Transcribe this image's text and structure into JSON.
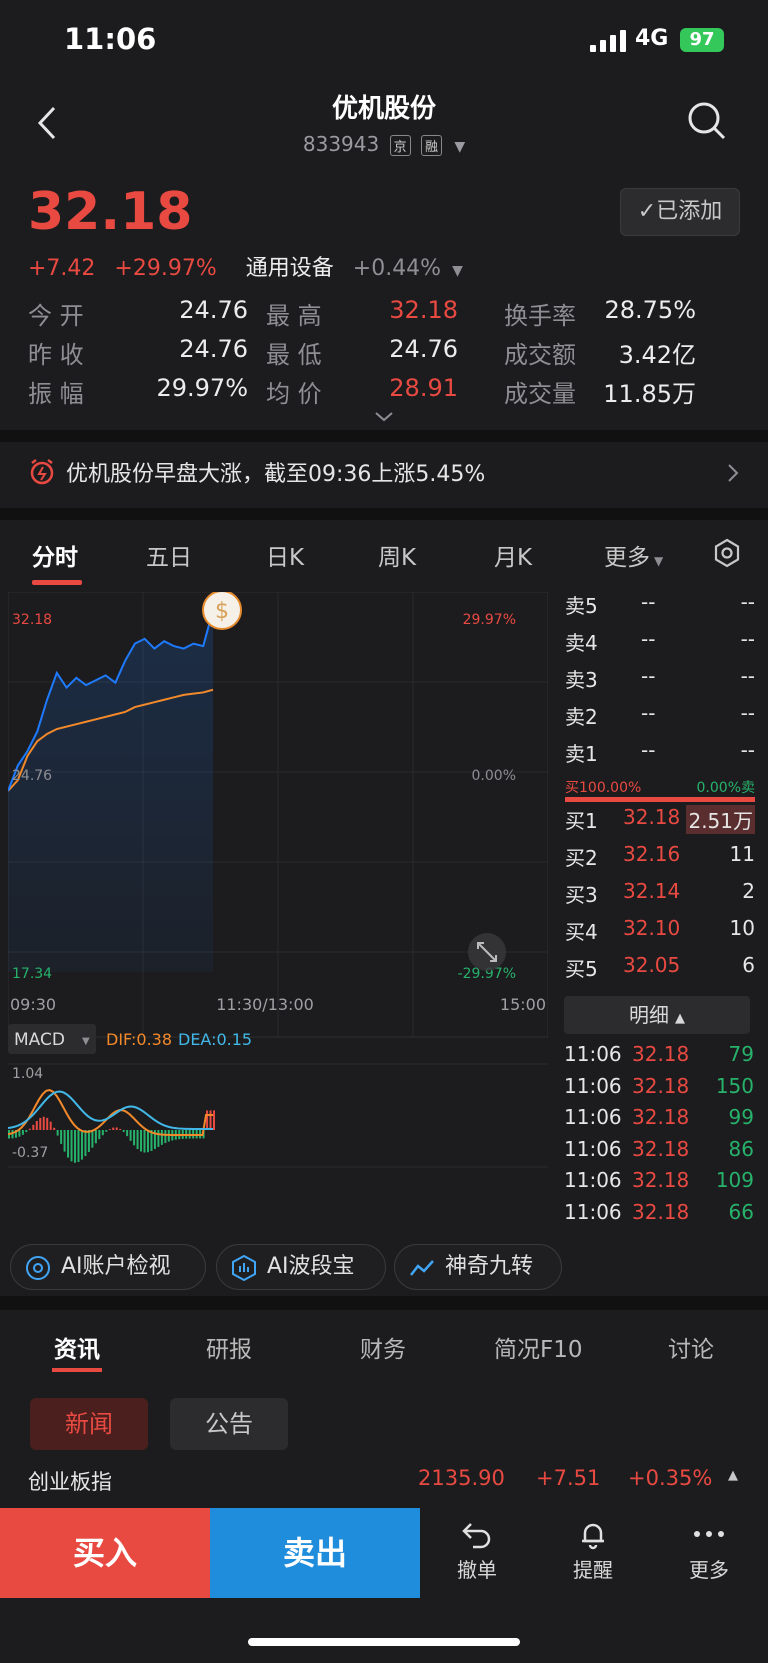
{
  "status_bar": {
    "time": "11:06",
    "network": "4G",
    "battery": "97"
  },
  "header": {
    "title": "优机股份",
    "code": "833943",
    "tag1": "京",
    "tag2": "融",
    "added_label": "✓已添加"
  },
  "quote": {
    "price": "32.18",
    "change": "+7.42",
    "change_pct": "+29.97%",
    "sector": "通用设备",
    "sector_pct": "+0.44%",
    "rows": [
      {
        "l1": "今 开",
        "v1": "24.76",
        "l2": "最 高",
        "v2": "32.18",
        "l3": "换手率",
        "v3": "28.75%"
      },
      {
        "l1": "昨 收",
        "v1": "24.76",
        "l2": "最 低",
        "v2": "24.76",
        "l3": "成交额",
        "v3": "3.42亿"
      },
      {
        "l1": "振 幅",
        "v1": "29.97%",
        "l2": "均 价",
        "v2": "28.91",
        "l3": "成交量",
        "v3": "11.85万"
      }
    ]
  },
  "news_alert": "优机股份早盘大涨，截至09:36上涨5.45%",
  "tabs": [
    "分时",
    "五日",
    "日K",
    "周K",
    "月K",
    "更多"
  ],
  "chart": {
    "price_top": "32.18",
    "pct_top": "29.97%",
    "price_mid": "24.76",
    "pct_mid": "0.00%",
    "price_bottom": "17.34",
    "pct_bottom": "-29.97%",
    "time_start": "09:30",
    "time_mid": "11:30/13:00",
    "time_end": "15:00",
    "macd_label": "MACD",
    "dif": "DIF:0.38",
    "dea": "DEA:0.15",
    "macd_max": "1.04",
    "macd_min": "-0.37",
    "marker": "$"
  },
  "chart_data": {
    "type": "line",
    "title": "",
    "xlabel": "",
    "ylabel": "",
    "x_ticks": [
      "09:30",
      "11:30/13:00",
      "15:00"
    ],
    "ylim": [
      17.34,
      32.18
    ],
    "series": [
      {
        "values": [
          24.76,
          25.8,
          26.4,
          27.2,
          28.5,
          29.6,
          29.0,
          29.4,
          29.1,
          29.3,
          29.5,
          29.2,
          30.1,
          30.8,
          31.0,
          30.6,
          30.9,
          30.7,
          30.6,
          30.8,
          30.7,
          32.18
        ]
      },
      {
        "values": [
          24.76,
          25.2,
          26.2,
          26.8,
          27.1,
          27.3,
          27.4,
          27.5,
          27.6,
          27.7,
          27.8,
          27.9,
          28.0,
          28.2,
          28.3,
          28.4,
          28.5,
          28.6,
          28.7,
          28.75,
          28.8,
          28.91
        ]
      }
    ],
    "macd_range": [
      -0.37,
      1.04
    ]
  },
  "order_book": {
    "sells": [
      {
        "label": "卖5",
        "price": "--",
        "vol": "--"
      },
      {
        "label": "卖4",
        "price": "--",
        "vol": "--"
      },
      {
        "label": "卖3",
        "price": "--",
        "vol": "--"
      },
      {
        "label": "卖2",
        "price": "--",
        "vol": "--"
      },
      {
        "label": "卖1",
        "price": "--",
        "vol": "--"
      }
    ],
    "ratio_buy": "买100.00%",
    "ratio_sell": "0.00%卖",
    "buys": [
      {
        "label": "买1",
        "price": "32.18",
        "vol": "2.51万"
      },
      {
        "label": "买2",
        "price": "32.16",
        "vol": "11"
      },
      {
        "label": "买3",
        "price": "32.14",
        "vol": "2"
      },
      {
        "label": "买4",
        "price": "32.10",
        "vol": "10"
      },
      {
        "label": "买5",
        "price": "32.05",
        "vol": "6"
      }
    ],
    "detail_label": "明细"
  },
  "ticks": [
    {
      "time": "11:06",
      "price": "32.18",
      "vol": "79"
    },
    {
      "time": "11:06",
      "price": "32.18",
      "vol": "150"
    },
    {
      "time": "11:06",
      "price": "32.18",
      "vol": "99"
    },
    {
      "time": "11:06",
      "price": "32.18",
      "vol": "86"
    },
    {
      "time": "11:06",
      "price": "32.18",
      "vol": "109"
    },
    {
      "time": "11:06",
      "price": "32.18",
      "vol": "66"
    }
  ],
  "ai_buttons": [
    "AI账户检视",
    "AI波段宝",
    "神奇九转"
  ],
  "info_tabs": [
    "资讯",
    "研报",
    "财务",
    "简况F10",
    "讨论"
  ],
  "chips": [
    "新闻",
    "公告"
  ],
  "index_bar": {
    "name": "创业板指",
    "value": "2135.90",
    "change": "+7.51",
    "pct": "+0.35%"
  },
  "actions": {
    "buy": "买入",
    "sell": "卖出",
    "cancel": "撤单",
    "alert": "提醒",
    "more": "更多"
  },
  "colors": {
    "up": "#e84a42",
    "down": "#27b26b",
    "sell_blue": "#1f8ddc",
    "price_line": "#1e7bff",
    "avg_line": "#f2892b"
  }
}
